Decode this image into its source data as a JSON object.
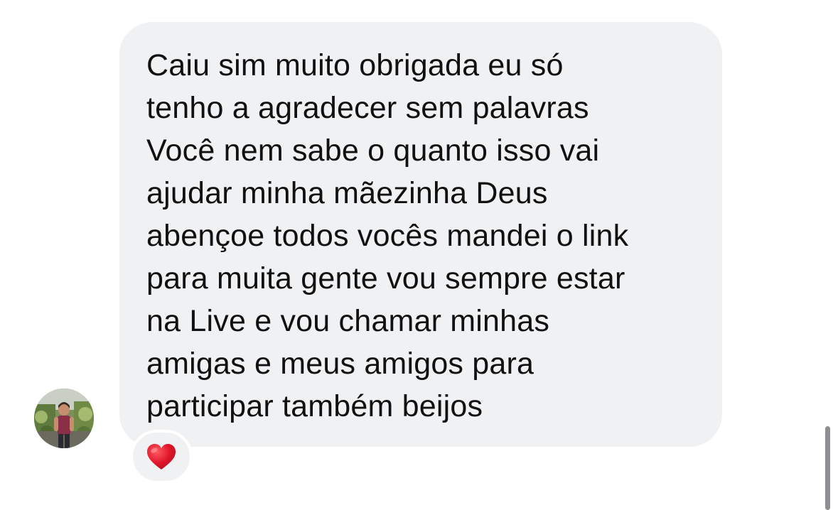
{
  "message": {
    "lines": [
      "Caiu sim muito obrigada eu só",
      "tenho a agradecer sem palavras",
      "Você nem sabe o quanto isso vai",
      "ajudar minha mãezinha Deus",
      "abençoe todos vocês mandei o link",
      "para muita gente vou sempre estar",
      "na Live e vou chamar minhas",
      "amigas e meus amigos para",
      "participar também beijos"
    ],
    "bubble_color": "#f0f1f3",
    "text_color": "#111111"
  },
  "reaction": {
    "icon": "red-heart-icon",
    "color": "#e0162b"
  },
  "sender": {
    "avatar": "avatar-photo"
  }
}
